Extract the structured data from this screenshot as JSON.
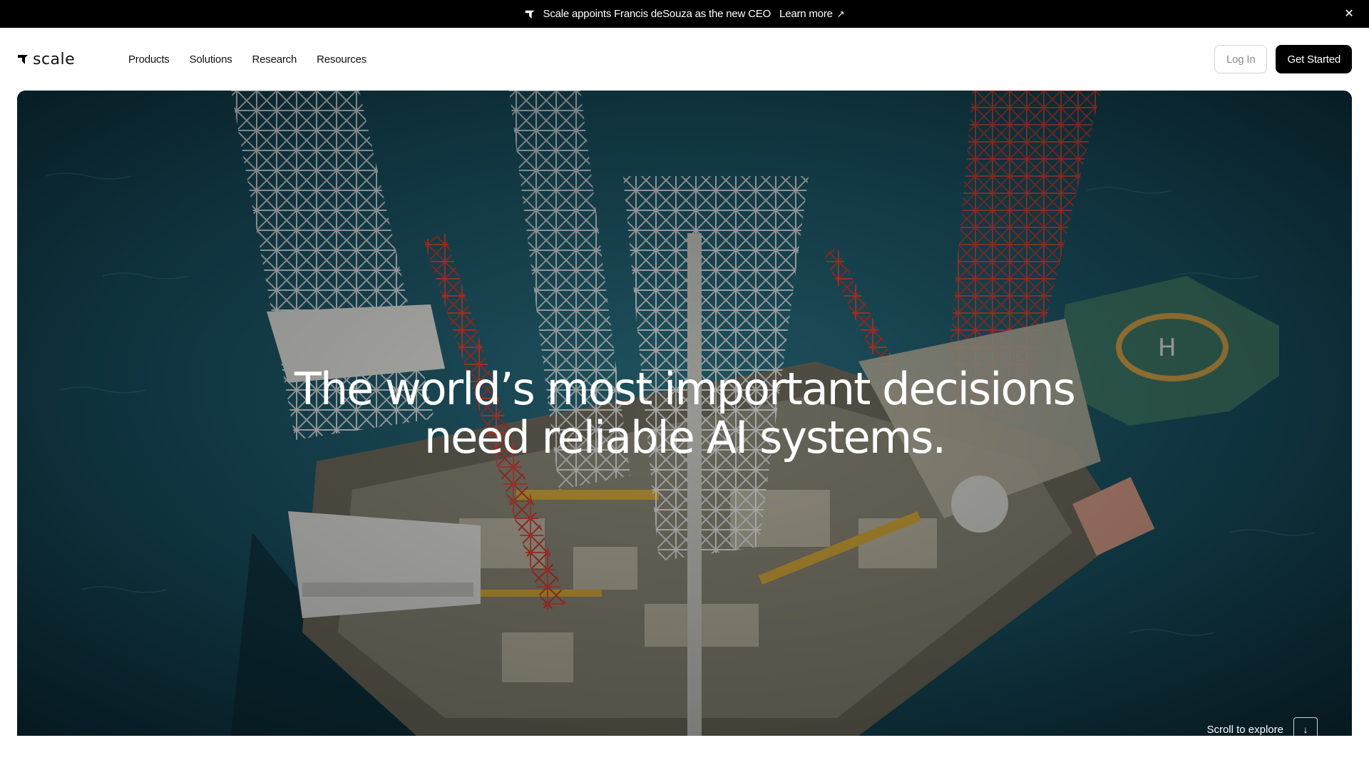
{
  "announcement": {
    "message": "Scale appoints Francis deSouza as the new CEO",
    "link_label": "Learn more",
    "arrow_glyph": "↗",
    "close_glyph": "✕"
  },
  "header": {
    "brand": "scale",
    "nav": [
      "Products",
      "Solutions",
      "Research",
      "Resources"
    ],
    "login_label": "Log In",
    "cta_label": "Get Started"
  },
  "hero": {
    "headline_line1": "The world’s most important decisions",
    "headline_line2": "need reliable AI systems.",
    "scroll_label": "Scroll to explore",
    "scroll_glyph": "↓"
  },
  "colors": {
    "accent": "#000000",
    "ocean": "#0f3c4a"
  }
}
